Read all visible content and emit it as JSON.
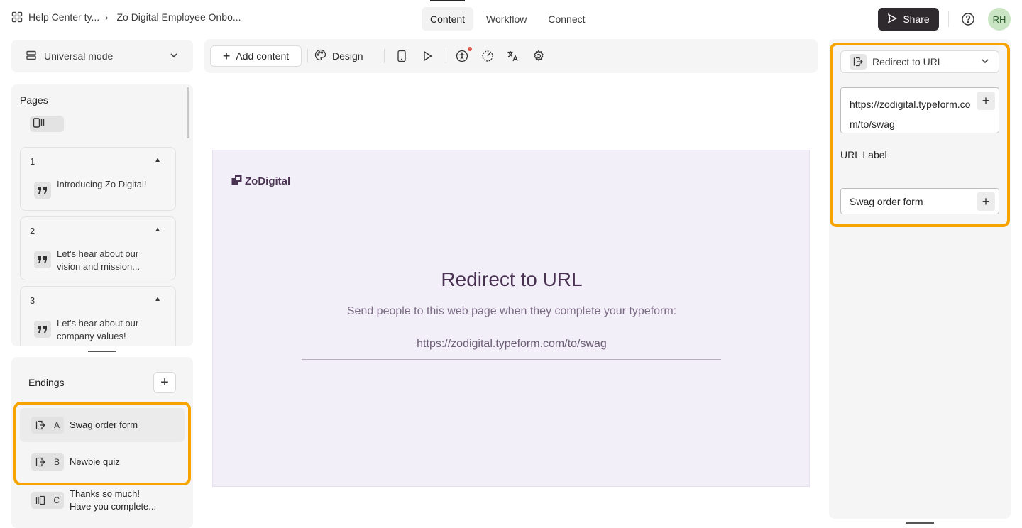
{
  "header": {
    "breadcrumb_workspace": "Help Center ty...",
    "breadcrumb_form": "Zo Digital Employee Onbo...",
    "tabs": [
      {
        "label": "Content"
      },
      {
        "label": "Workflow"
      },
      {
        "label": "Connect"
      }
    ],
    "share_label": "Share",
    "avatar_initials": "RH"
  },
  "sidebar": {
    "mode_label": "Universal mode",
    "pages_title": "Pages",
    "pages": [
      {
        "number": "1",
        "text": "Introducing Zo Digital!"
      },
      {
        "number": "2",
        "text": "Let's hear about our vision and mission..."
      },
      {
        "number": "3",
        "text": "Let's hear about our company values!"
      }
    ],
    "endings_title": "Endings",
    "endings": [
      {
        "letter": "A",
        "text": "Swag order form"
      },
      {
        "letter": "B",
        "text": "Newbie quiz"
      },
      {
        "letter": "C",
        "text": "Thanks so much! Have you complete..."
      }
    ]
  },
  "toolbar": {
    "add_content_label": "Add content",
    "design_label": "Design"
  },
  "preview": {
    "logo_text": "ZoDigital",
    "title": "Redirect to URL",
    "subtitle": "Send people to this web page when they complete your typeform:",
    "url": "https://zodigital.typeform.com/to/swag"
  },
  "settings": {
    "ending_type": "Redirect to URL",
    "url_value": "https://zodigital.typeform.com/to/swag",
    "url_label_heading": "URL Label",
    "url_label_value": "Swag order form"
  },
  "colors": {
    "highlight": "#f7a400",
    "share_bg": "#2f2a2e",
    "preview_bg": "#f3eff9",
    "brand_text": "#4a3253",
    "avatar_bg": "#c9e5c3"
  }
}
